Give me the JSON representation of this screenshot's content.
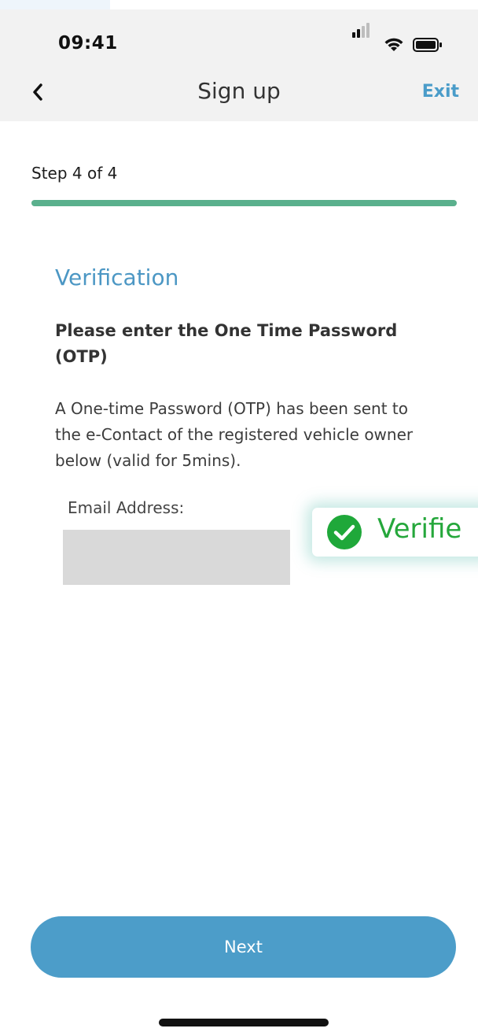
{
  "status_bar": {
    "time": "09:41",
    "icons": [
      "signal-icon",
      "wifi-icon",
      "battery-icon"
    ]
  },
  "nav": {
    "back_icon": "chevron-left-icon",
    "title": "Sign up",
    "exit_label": "Exit"
  },
  "progress": {
    "step_label": "Step 4 of 4",
    "current_step": 4,
    "total_steps": 4,
    "fill_fraction": 1.0
  },
  "verification": {
    "title": "Verification",
    "instruction": "Please enter the One Time Password (OTP)",
    "description": "A One-time Password (OTP) has been sent to the e-Contact of the registered vehicle owner below (valid for 5mins).",
    "email_label": "Email Address:",
    "email_value": ""
  },
  "badge": {
    "icon": "check-circle-icon",
    "text": "Verifie"
  },
  "footer": {
    "next_label": "Next"
  },
  "colors": {
    "accent_blue": "#4c9dc9",
    "progress_green": "#5ab08d",
    "verified_green": "#25a73b",
    "header_bg": "#f2f2f2",
    "redaction_gray": "#d9d9d9"
  }
}
